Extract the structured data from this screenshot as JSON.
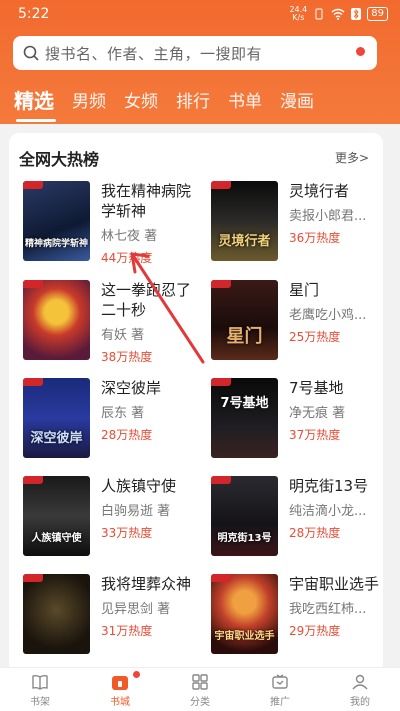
{
  "status": {
    "time": "5:22",
    "speed_value": "24.4",
    "speed_unit": "K/s",
    "battery": "89"
  },
  "search": {
    "placeholder": "搜书名、作者、主角，一搜即有"
  },
  "tabs": [
    {
      "label": "精选",
      "active": true
    },
    {
      "label": "男频"
    },
    {
      "label": "女频"
    },
    {
      "label": "排行"
    },
    {
      "label": "书单"
    },
    {
      "label": "漫画"
    }
  ],
  "section": {
    "title": "全网大热榜",
    "more": "更多>"
  },
  "books": [
    {
      "title": "我在精神病院学斩神",
      "author": "林七夜 著",
      "heat": "44万热度",
      "cover_text": "精神病院学斩神"
    },
    {
      "title": "灵境行者",
      "author": "卖报小郎君...",
      "heat": "36万热度",
      "cover_text": "灵境行者"
    },
    {
      "title": "这一拳跑忍了二十秒",
      "author": "有妖 著",
      "heat": "38万热度",
      "cover_text": ""
    },
    {
      "title": "星门",
      "author": "老鹰吃小鸡...",
      "heat": "25万热度",
      "cover_text": "星门"
    },
    {
      "title": "深空彼岸",
      "author": "辰东 著",
      "heat": "28万热度",
      "cover_text": "深空彼岸"
    },
    {
      "title": "7号基地",
      "author": "净无痕 著",
      "heat": "37万热度",
      "cover_text": "7号基地"
    },
    {
      "title": "人族镇守使",
      "author": "白驹易逝 著",
      "heat": "33万热度",
      "cover_text": "人族镇守使"
    },
    {
      "title": "明克街13号",
      "author": "纯洁滴小龙...",
      "heat": "28万热度",
      "cover_text": "明克街13号"
    },
    {
      "title": "我将埋葬众神",
      "author": "见异思剑 著",
      "heat": "31万热度",
      "cover_text": ""
    },
    {
      "title": "宇宙职业选手",
      "author": "我吃西红柿...",
      "heat": "29万热度",
      "cover_text": "宇宙职业选手"
    }
  ],
  "nav": [
    {
      "label": "书架",
      "icon": "bookshelf-icon"
    },
    {
      "label": "书城",
      "icon": "store-icon",
      "active": true
    },
    {
      "label": "分类",
      "icon": "category-icon"
    },
    {
      "label": "推广",
      "icon": "promote-icon"
    },
    {
      "label": "我的",
      "icon": "profile-icon"
    }
  ],
  "colors": {
    "brand": "#f26a2e",
    "heat": "#ea4b34",
    "annotation": "#e23a3a"
  }
}
